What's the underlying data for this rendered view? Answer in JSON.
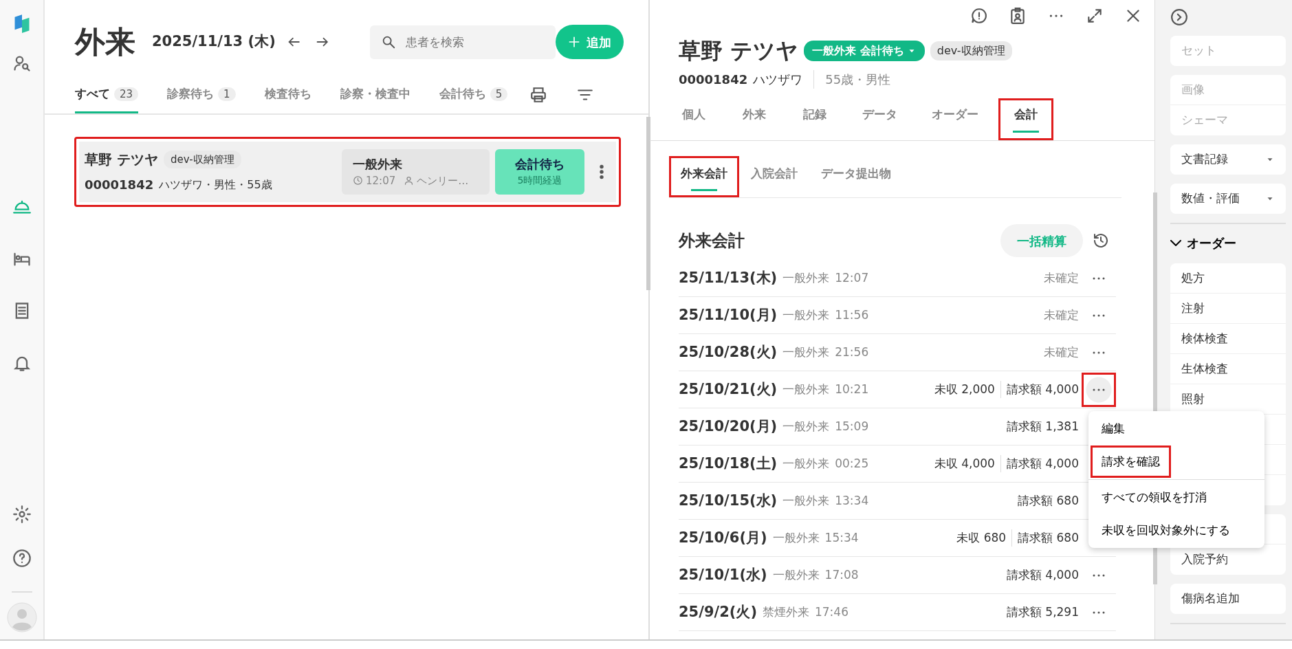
{
  "nav": {
    "items": [
      {
        "selected": false
      },
      {
        "selected": true
      },
      {
        "selected": false
      },
      {
        "selected": false
      },
      {
        "selected": false
      }
    ],
    "bottom": [
      {
        "selected": false
      },
      {
        "selected": false
      }
    ]
  },
  "list_panel": {
    "title": "外来",
    "date": "2025/11/13 (木)",
    "search": {
      "placeholder": "患者を検索"
    },
    "add_button": "追加",
    "tabs": [
      {
        "label": "すべて",
        "count": "23",
        "selected": true
      },
      {
        "label": "診察待ち",
        "count": "1",
        "selected": false
      },
      {
        "label": "検査待ち",
        "selected": false
      },
      {
        "label": "診察・検査中",
        "selected": false
      },
      {
        "label": "会計待ち",
        "count": "5",
        "selected": false
      }
    ],
    "patients": [
      {
        "name": "草野 テツヤ",
        "tag": "dev-収納管理",
        "id": "00001842",
        "info": "ハツザワ・男性・55歳",
        "visit_type": "一般外来",
        "time": "12:07",
        "doctor": "ヘンリー…",
        "status": "会計待ち",
        "elapsed": "5時間経過",
        "highlighted": true
      }
    ]
  },
  "detail_panel": {
    "patient": {
      "name": "草野 テツヤ",
      "status_badge": "一般外来 会計待ち",
      "tag": "dev-収納管理",
      "id": "00001842",
      "kana": "ハツザワ",
      "age_sex": "55歳・男性"
    },
    "tabs": [
      {
        "label": "個人",
        "selected": false,
        "highlighted": false
      },
      {
        "label": "外来",
        "selected": false,
        "highlighted": false
      },
      {
        "label": "記録",
        "selected": false,
        "highlighted": false
      },
      {
        "label": "データ",
        "selected": false,
        "highlighted": false
      },
      {
        "label": "オーダー",
        "selected": false,
        "highlighted": false
      },
      {
        "label": "会計",
        "selected": true,
        "highlighted": true
      }
    ],
    "subtabs": [
      {
        "label": "外来会計",
        "selected": true,
        "highlighted": true
      },
      {
        "label": "入院会計",
        "selected": false,
        "highlighted": false
      },
      {
        "label": "データ提出物",
        "selected": false,
        "highlighted": false
      }
    ],
    "section_title": "外来会計",
    "bulk_button": "一括精算",
    "rows": [
      {
        "date": "25/11/13(木)",
        "type": "一般外来",
        "time": "12:07",
        "status": "未確定",
        "menu_open": false,
        "highlighted": false
      },
      {
        "date": "25/11/10(月)",
        "type": "一般外来",
        "time": "11:56",
        "status": "未確定",
        "menu_open": false,
        "highlighted": false
      },
      {
        "date": "25/10/28(火)",
        "type": "一般外来",
        "time": "21:56",
        "status": "未確定",
        "menu_open": false,
        "highlighted": false
      },
      {
        "date": "25/10/21(火)",
        "type": "一般外来",
        "time": "10:21",
        "uncollected": "未収 2,000",
        "billed": "請求額 4,000",
        "menu_open": true,
        "highlighted": true
      },
      {
        "date": "25/10/20(月)",
        "type": "一般外来",
        "time": "15:09",
        "billed": "請求額 1,381"
      },
      {
        "date": "25/10/18(土)",
        "type": "一般外来",
        "time": "00:25",
        "uncollected": "未収 4,000",
        "billed": "請求額 4,000"
      },
      {
        "date": "25/10/15(水)",
        "type": "一般外来",
        "time": "13:34",
        "billed": "請求額 680"
      },
      {
        "date": "25/10/6(月)",
        "type": "一般外来",
        "time": "15:34",
        "uncollected": "未収 680",
        "billed": "請求額 680"
      },
      {
        "date": "25/10/1(水)",
        "type": "一般外来",
        "time": "17:08",
        "billed": "請求額 4,000",
        "menu_open": false,
        "highlighted": false
      },
      {
        "date": "25/9/2(火)",
        "type": "禁煙外来",
        "time": "17:46",
        "billed": "請求額 5,291",
        "menu_open": false,
        "highlighted": false
      }
    ],
    "menu": {
      "items": [
        {
          "label": "編集",
          "highlighted": false,
          "divider_after": false
        },
        {
          "label": "請求を確認",
          "highlighted": true,
          "divider_after": true
        },
        {
          "label": "すべての領収を打消",
          "highlighted": false,
          "divider_after": false
        },
        {
          "label": "未収を回収対象外にする",
          "highlighted": false,
          "divider_after": false
        }
      ]
    }
  },
  "tool_sidebar": {
    "groups": [
      {
        "items": [
          {
            "label": "セット",
            "kind": "muted"
          }
        ]
      },
      {
        "items": [
          {
            "label": "画像",
            "kind": "muted"
          },
          {
            "label": "シェーマ",
            "kind": "muted"
          }
        ]
      },
      {
        "items": [
          {
            "label": "文書記録",
            "kind": "dropdown"
          }
        ]
      },
      {
        "items": [
          {
            "label": "数値・評価",
            "kind": "dropdown"
          }
        ]
      }
    ],
    "section": {
      "label": "オーダー",
      "expanded": true,
      "groups": [
        {
          "items": [
            {
              "label": "処方",
              "kind": "plain"
            },
            {
              "label": "注射",
              "kind": "plain"
            },
            {
              "label": "検体検査",
              "kind": "plain"
            },
            {
              "label": "生体検査",
              "kind": "plain"
            },
            {
              "label": "照射",
              "kind": "plain"
            },
            {
              "kind": "covered"
            },
            {
              "kind": "covered"
            },
            {
              "kind": "covered"
            }
          ]
        },
        {
          "items": [
            {
              "kind": "covered"
            },
            {
              "label": "入院予約",
              "kind": "plain"
            }
          ]
        },
        {
          "items": [
            {
              "label": "傷病名追加",
              "kind": "plain"
            }
          ]
        }
      ]
    }
  }
}
